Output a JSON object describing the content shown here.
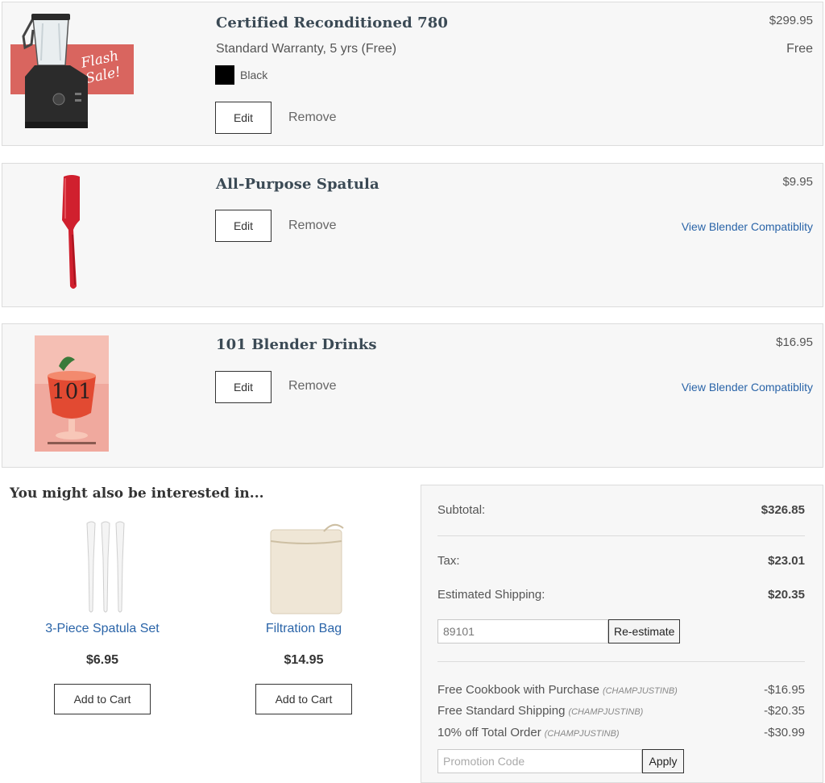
{
  "cart": {
    "items": [
      {
        "title": "Certified Reconditioned 780",
        "price": "$299.95",
        "warranty": "Standard Warranty, 5 yrs (Free)",
        "warranty_price": "Free",
        "color_label": "Black",
        "badge": "Flash Sale!",
        "edit_label": "Edit",
        "remove_label": "Remove"
      },
      {
        "title": "All-Purpose Spatula",
        "price": "$9.95",
        "edit_label": "Edit",
        "remove_label": "Remove",
        "compat_label": "View Blender Compatiblity"
      },
      {
        "title": "101 Blender Drinks",
        "price": "$16.95",
        "edit_label": "Edit",
        "remove_label": "Remove",
        "compat_label": "View Blender Compatiblity",
        "cover_text": "101"
      }
    ]
  },
  "recommendations": {
    "heading": "You might also be interested in...",
    "items": [
      {
        "name": "3-Piece Spatula Set",
        "price": "$6.95",
        "button": "Add to Cart"
      },
      {
        "name": "Filtration Bag",
        "price": "$14.95",
        "button": "Add to Cart"
      }
    ]
  },
  "summary": {
    "subtotal_label": "Subtotal:",
    "subtotal": "$326.85",
    "tax_label": "Tax:",
    "tax": "$23.01",
    "shipping_label": "Estimated Shipping:",
    "shipping": "$20.35",
    "zip_value": "89101",
    "reestimate_label": "Re-estimate",
    "discounts": [
      {
        "label": "Free Cookbook with Purchase",
        "code": "(CHAMPJUSTINB)",
        "amount": "-$16.95"
      },
      {
        "label": "Free Standard Shipping",
        "code": "(CHAMPJUSTINB)",
        "amount": "-$20.35"
      },
      {
        "label": "10% off Total Order",
        "code": "(CHAMPJUSTINB)",
        "amount": "-$30.99"
      }
    ],
    "promo_placeholder": "Promotion Code",
    "apply_label": "Apply"
  },
  "colors": {
    "link": "#2a64a8",
    "title": "#3b4a55",
    "flash_sale": "#d9655f",
    "spatula_red": "#d0202e",
    "border": "#dcdcdc"
  }
}
